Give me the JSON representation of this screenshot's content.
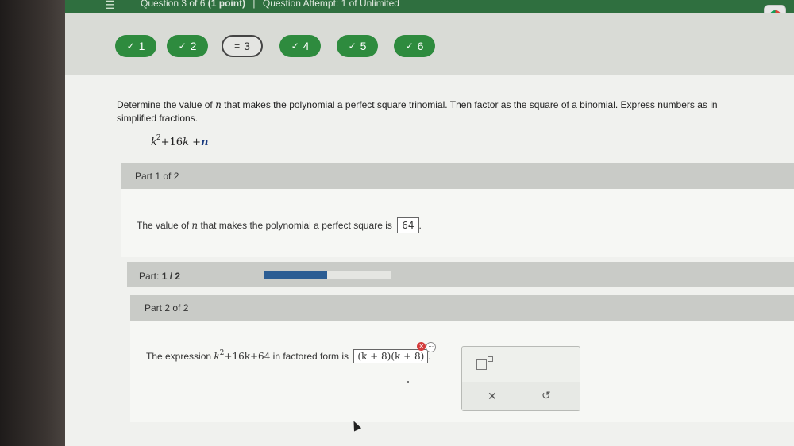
{
  "topbar": {
    "question_label": "Question 3 of 6",
    "points": "(1 point)",
    "separator": "|",
    "attempt": "Question Attempt: 1 of Unlimited"
  },
  "nav": {
    "questions": [
      {
        "label": "1",
        "status": "complete",
        "icon": "check-icon"
      },
      {
        "label": "2",
        "status": "complete",
        "icon": "check-icon"
      },
      {
        "label": "3",
        "status": "current",
        "icon": "equals-icon"
      },
      {
        "label": "4",
        "status": "complete",
        "icon": "check-icon"
      },
      {
        "label": "5",
        "status": "complete",
        "icon": "check-icon"
      },
      {
        "label": "6",
        "status": "complete",
        "icon": "check-icon"
      }
    ]
  },
  "question": {
    "prompt_pre": "Determine the value of ",
    "prompt_var": "n",
    "prompt_post": " that makes the polynomial a perfect square trinomial. Then factor as the square of a binomial. Express numbers as in",
    "prompt_line2": "simplified fractions.",
    "poly": {
      "var": "k",
      "exp": "2",
      "rest": "+16",
      "var2": "k",
      "plus": "+",
      "n": "n"
    }
  },
  "part1": {
    "header": "Part 1 of 2",
    "text_pre": "The value of ",
    "var": "n",
    "text_post": " that makes the polynomial a perfect square is",
    "answer": "64",
    "period": "."
  },
  "progress": {
    "label_prefix": "Part: ",
    "label_value": "1 / 2",
    "fraction": 0.5
  },
  "part2": {
    "header": "Part 2 of 2",
    "text_pre": "The expression ",
    "expr_var": "k",
    "expr_exp": "2",
    "expr_rest": "+16k+64",
    "text_post": " in factored form is",
    "answer": "(k + 8)(k + 8)",
    "period": "."
  },
  "colors": {
    "topbar": "#2f6f3f",
    "complete": "#2e8b3e",
    "progress_fill": "#2b5d93",
    "error_badge": "#d43c3c"
  }
}
